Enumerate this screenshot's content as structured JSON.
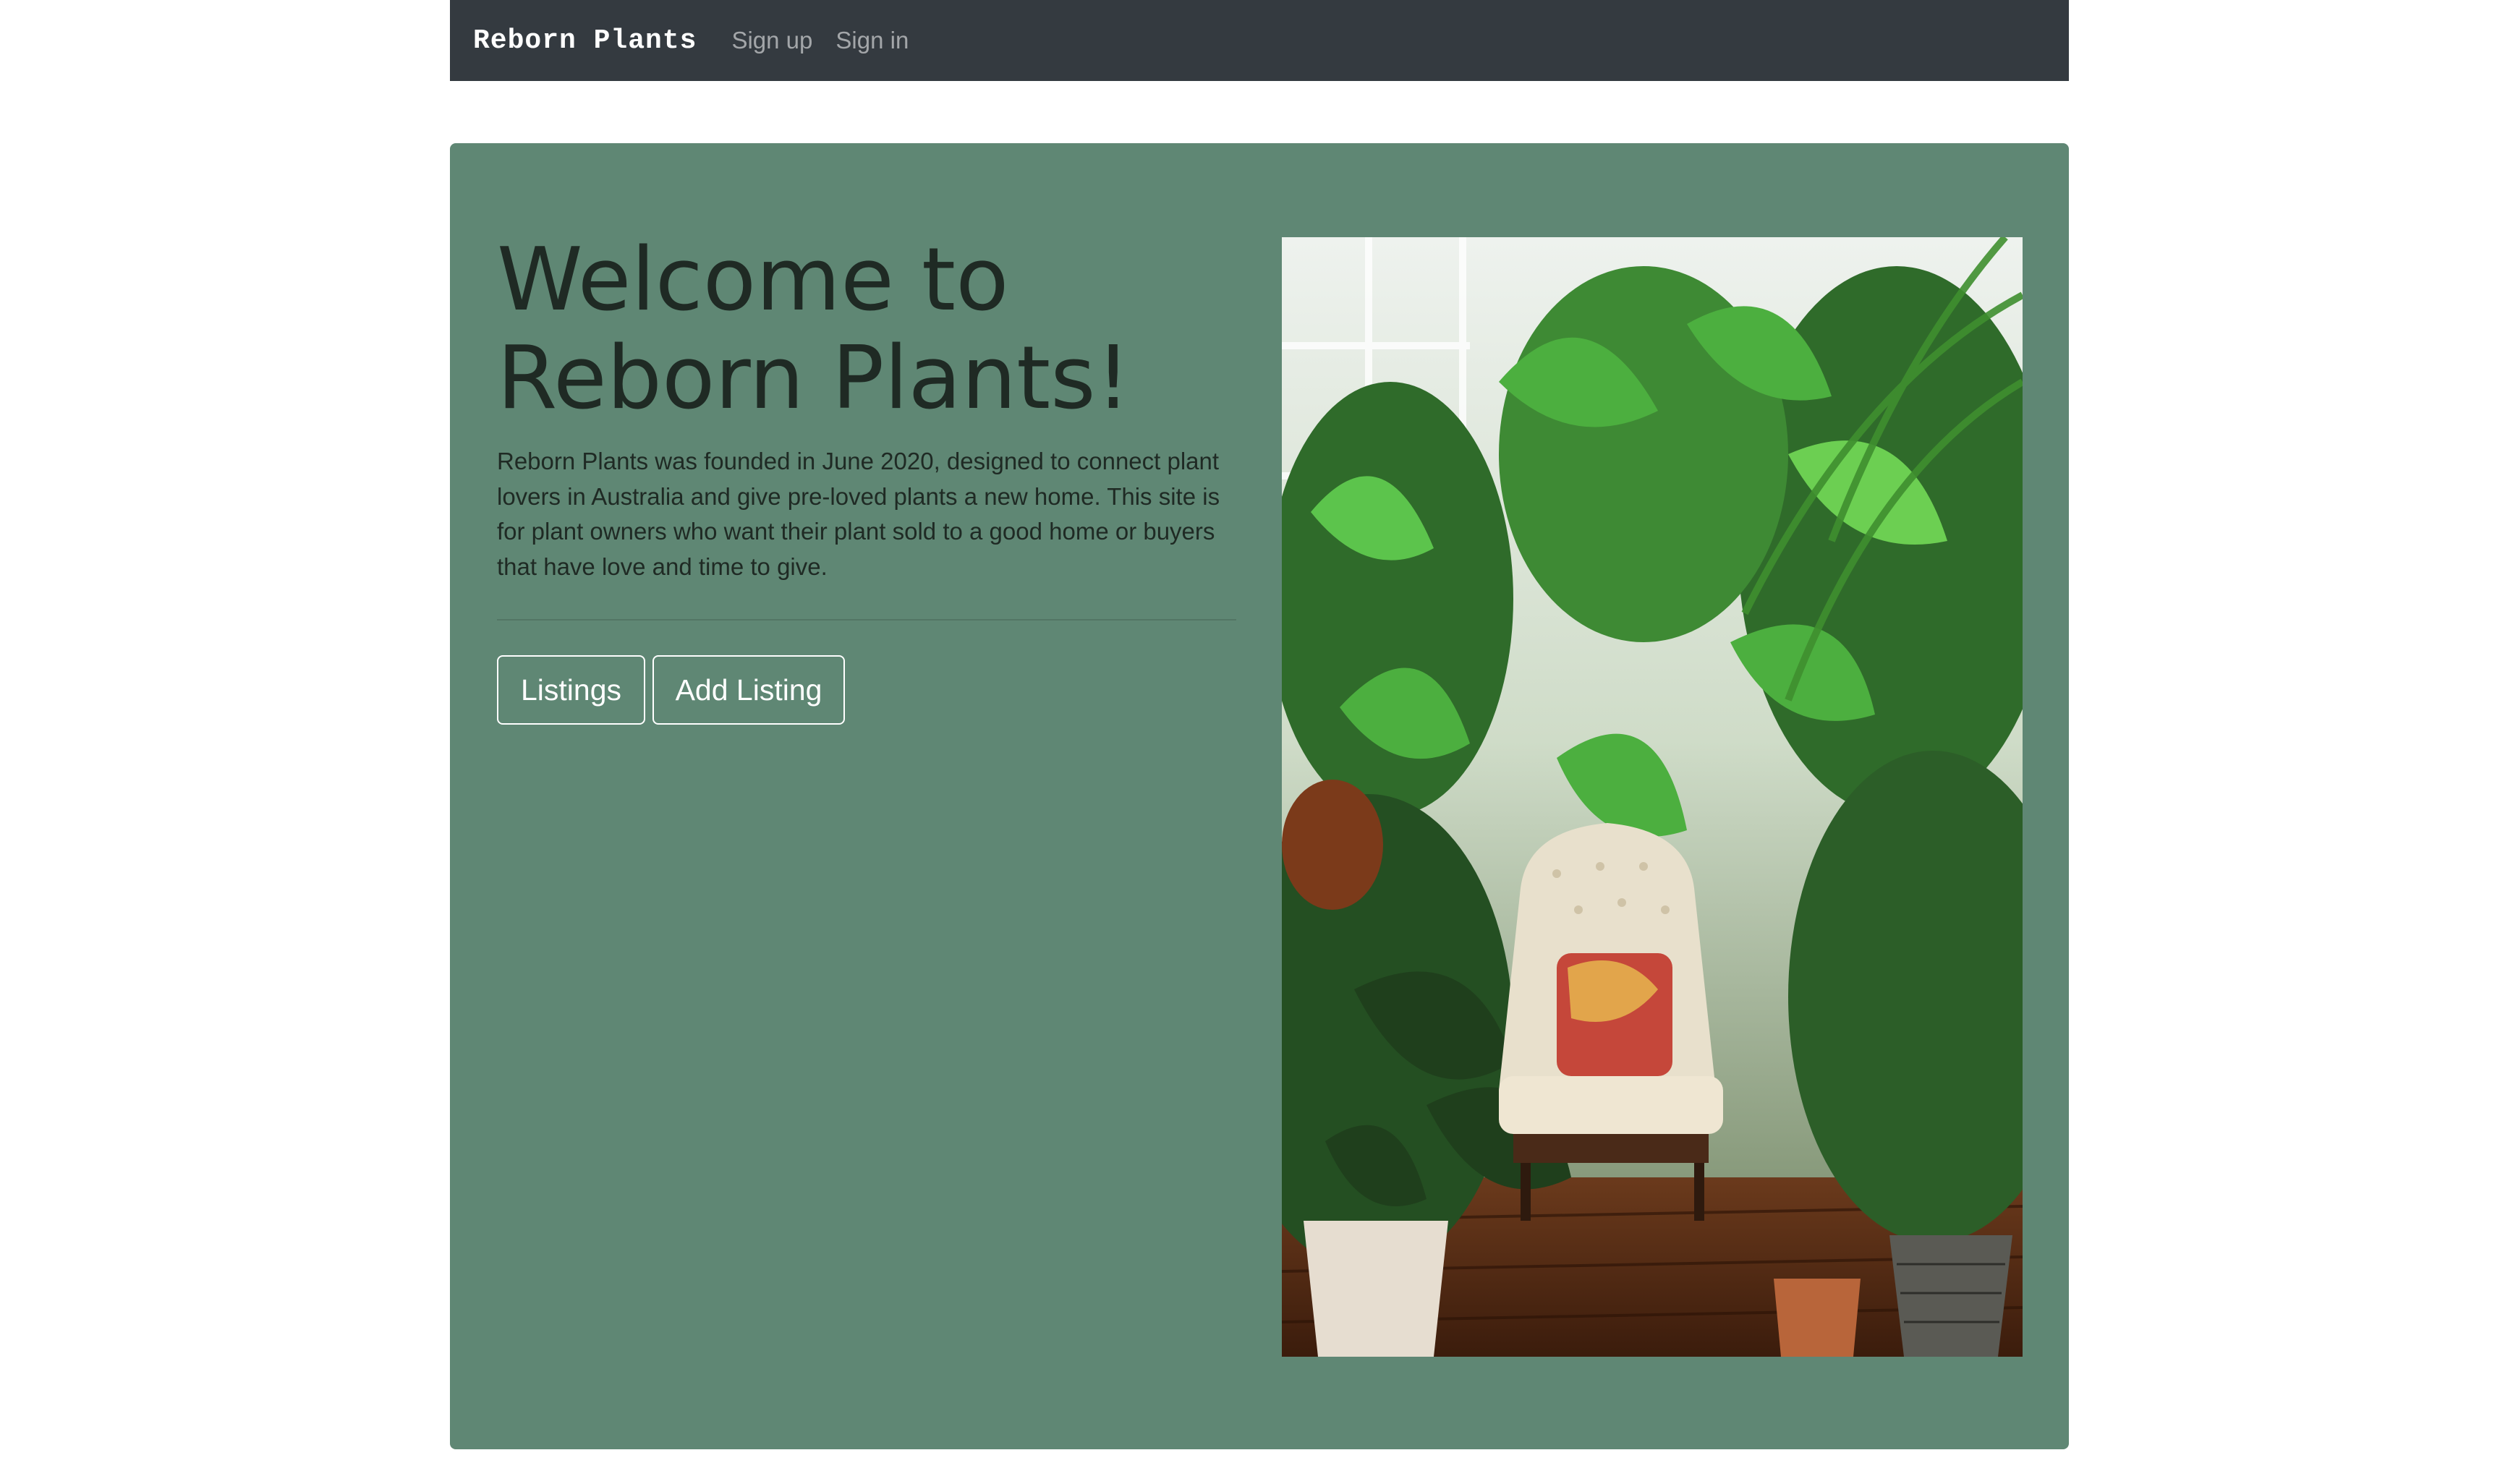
{
  "navbar": {
    "brand": "Reborn Plants",
    "links": [
      "Sign up",
      "Sign in"
    ]
  },
  "hero": {
    "title_line1": "Welcome to",
    "title_line2": "Reborn Plants!",
    "description": "Reborn Plants was founded in June 2020, designed to connect plant lovers in Australia and give pre-loved plants a new home. This site is for plant owners who want their plant sold to a good home or buyers that have love and time to give.",
    "buttons": {
      "listings": "Listings",
      "add_listing": "Add Listing"
    }
  },
  "colors": {
    "navbar_bg": "#343a40",
    "hero_bg": "#5f8774",
    "text_dark": "#1f2a24",
    "button_border": "#ffffff"
  }
}
